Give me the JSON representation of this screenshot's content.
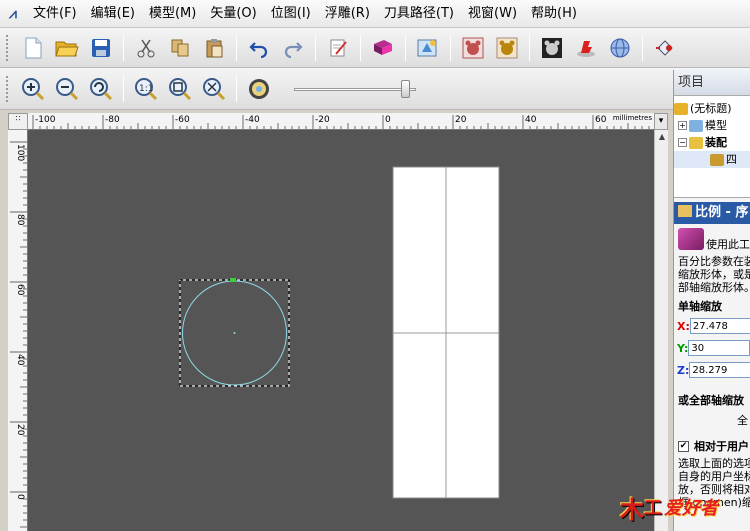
{
  "menu": {
    "app_icon": "artcam-icon",
    "items": [
      "文件(F)",
      "编辑(E)",
      "模型(M)",
      "矢量(O)",
      "位图(I)",
      "浮雕(R)",
      "刀具路径(T)",
      "视窗(W)",
      "帮助(H)"
    ]
  },
  "toolbar1": {
    "buttons": [
      "new-file-icon",
      "open-folder-icon",
      "save-icon",
      "cut-icon",
      "copy-icon",
      "paste-icon",
      "undo-icon",
      "redo-icon",
      "notes-icon",
      "book-icon",
      "model-icon",
      "relief-bear-icon",
      "relief-bear-2-icon",
      "relief-gray-icon",
      "relief-red-icon",
      "sphere-icon",
      "toolpath-icon"
    ]
  },
  "toolbar2": {
    "buttons": [
      "zoom-in-icon",
      "zoom-out-icon",
      "zoom-previous-icon",
      "zoom-1-1-icon",
      "zoom-fit-icon",
      "zoom-all-icon",
      "color-picker-icon"
    ],
    "slider_value": 0.9
  },
  "ruler": {
    "units": "millimetres",
    "h_ticks": [
      "-100",
      "-80",
      "-60",
      "-40",
      "-20",
      "0",
      "20",
      "40",
      "60"
    ],
    "v_ticks": [
      "100",
      "80",
      "60",
      "40",
      "20",
      "0"
    ]
  },
  "panel": {
    "header": "项目",
    "tree": {
      "root": "(无标题)",
      "model": "模型",
      "assembly": "装配",
      "child": "四"
    },
    "section_title": "比例 - 序",
    "desc_lines": [
      "使用此工",
      "百分比参数在装",
      "缩放形体，或是",
      "部轴缩放形体。"
    ],
    "single_axis_heading": "单轴缩放",
    "x_label": "X:",
    "x_value": "27.478",
    "y_label": "Y:",
    "y_value": "30",
    "z_label": "Z:",
    "z_value": "28.279",
    "all_axis_heading": "或全部轴缩放",
    "all_axis_extra": "全",
    "checkbox_label": "相对于用户",
    "checkbox_mark": "✔",
    "note_lines": [
      "选取上面的选项",
      "自身的用户坐标",
      "放，否则将相对",
      "框 gnomen)缩放"
    ]
  },
  "watermark": {
    "logo_char": "木",
    "text": "爱好者"
  }
}
